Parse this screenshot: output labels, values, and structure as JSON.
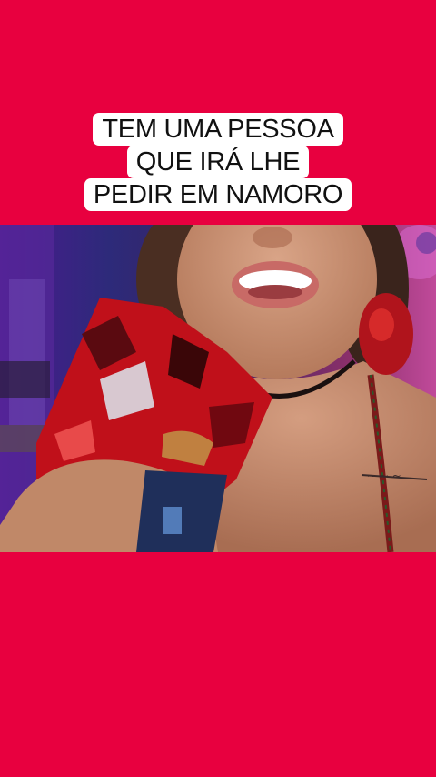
{
  "caption": {
    "lines": [
      "TEM UMA PESSOA",
      "QUE IRÁ LHE",
      "PEDIR EM NAMORO"
    ]
  },
  "colors": {
    "background": "#e8003f",
    "caption_bg": "#ffffff",
    "caption_text": "#111111"
  },
  "video": {
    "description_icon": "video-frame-image"
  }
}
